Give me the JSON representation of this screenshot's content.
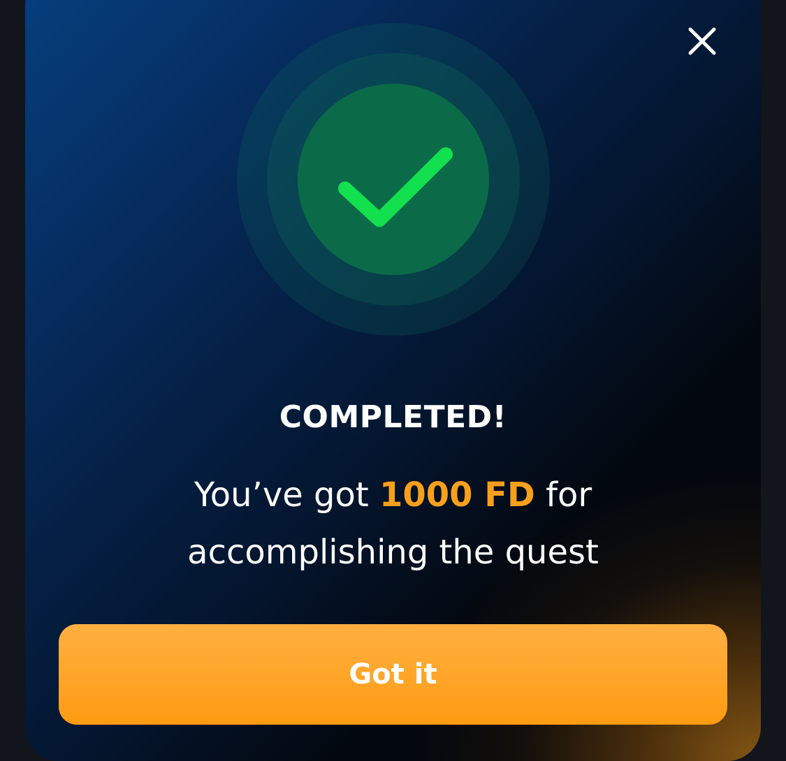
{
  "dialog": {
    "title": "COMPLETED!",
    "message_prefix": "You’ve got ",
    "reward_amount": "1000 FD",
    "message_suffix_line1": " for",
    "message_line2": "accomplishing the quest",
    "button_label": "Got it",
    "status_icon": "check-icon",
    "close_icon": "close-icon"
  },
  "colors": {
    "accent": "#f7a01c",
    "button": "#ffa01c",
    "success": "#13e04f",
    "success_circle": "#0b6b49"
  }
}
